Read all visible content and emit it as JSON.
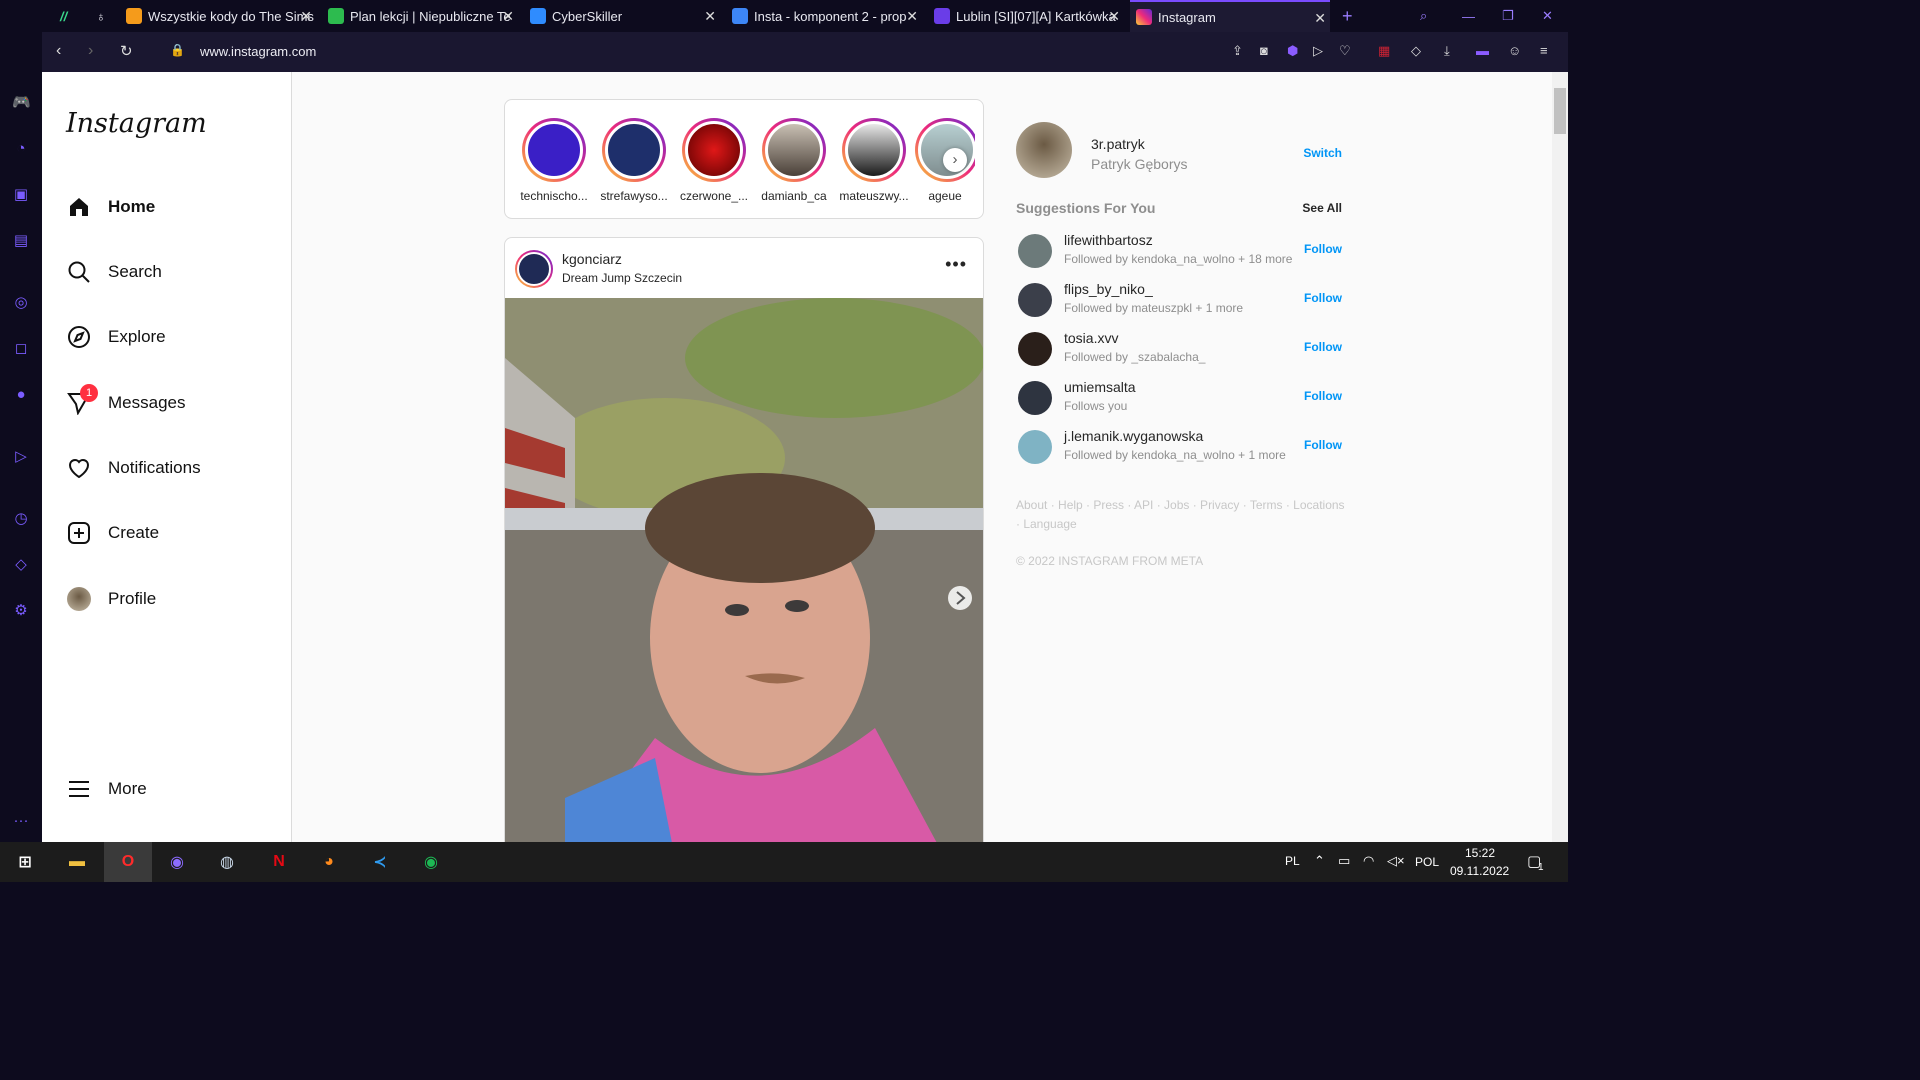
{
  "browser": {
    "tabs": [
      {
        "title": "Wszystkie kody do The Sims",
        "icon": "sims-icon",
        "color": "#f59b1b"
      },
      {
        "title": "Plan lekcji | Niepubliczne Te",
        "icon": "plan-icon",
        "color": "#2dbb4f"
      },
      {
        "title": "CyberSkiller",
        "icon": "cyberskiller-icon",
        "color": "#2f8cff"
      },
      {
        "title": "Insta - komponent 2 - prop",
        "icon": "doc-icon",
        "color": "#3d86f6"
      },
      {
        "title": "Lublin [SI][07][A] Kartkówka",
        "icon": "list-icon",
        "color": "#6a3de8"
      },
      {
        "title": "Instagram",
        "icon": "instagram-icon",
        "color": "#e1306c"
      }
    ],
    "url": "www.instagram.com"
  },
  "instagram": {
    "logo": "Instagram",
    "nav": [
      {
        "label": "Home"
      },
      {
        "label": "Search"
      },
      {
        "label": "Explore"
      },
      {
        "label": "Messages",
        "badge": "1"
      },
      {
        "label": "Notifications"
      },
      {
        "label": "Create"
      },
      {
        "label": "Profile"
      }
    ],
    "more": "More",
    "stories": [
      "technischo...",
      "strefawyso...",
      "czerwone_...",
      "damianb_ca",
      "mateuszwy...",
      "ageue"
    ],
    "post": {
      "username": "kgonciarz",
      "location": "Dream Jump Szczecin",
      "more_symbol": "•••"
    },
    "me": {
      "username": "3r.patryk",
      "name": "Patryk Gęborys",
      "switch": "Switch"
    },
    "suggestions_title": "Suggestions For You",
    "see_all": "See All",
    "suggestions": [
      {
        "username": "lifewithbartosz",
        "sub": "Followed by kendoka_na_wolno + 18 more",
        "action": "Follow"
      },
      {
        "username": "flips_by_niko_",
        "sub": "Followed by mateuszpkl + 1 more",
        "action": "Follow"
      },
      {
        "username": "tosia.xvv",
        "sub": "Followed by _szabalacha_",
        "action": "Follow"
      },
      {
        "username": "umiemsalta",
        "sub": "Follows you",
        "action": "Follow"
      },
      {
        "username": "j.lemanik.wyganowska",
        "sub": "Followed by kendoka_na_wolno + 1 more",
        "action": "Follow"
      }
    ],
    "footer_links": "About · Help · Press · API · Jobs · Privacy · Terms · Locations · Language",
    "copyright": "© 2022 INSTAGRAM FROM META"
  },
  "taskbar": {
    "language": "PL",
    "lang_code": "POL",
    "time": "15:22",
    "date": "09.11.2022",
    "notifications": "1"
  },
  "colors": {
    "accent": "#0095f6",
    "badge": "#ff3040",
    "opera_purple": "#7a4cff"
  }
}
